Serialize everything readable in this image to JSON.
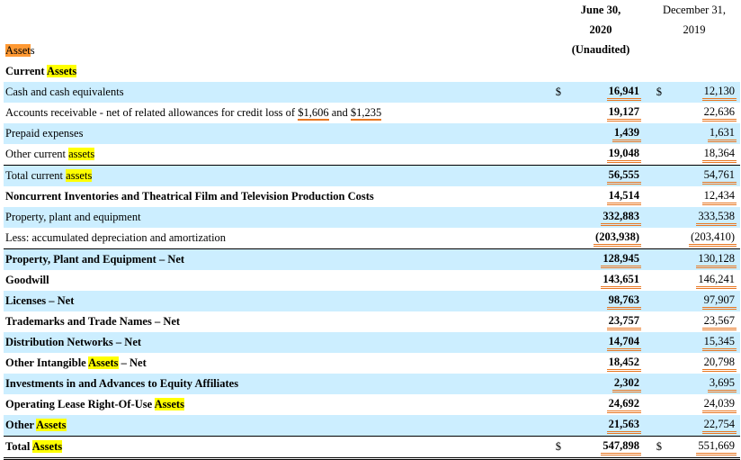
{
  "header": {
    "col1_line1": "June 30,",
    "col1_line2": "2020",
    "col1_line3": "(Unaudited)",
    "col2_line1": "December 31,",
    "col2_line2": "2019"
  },
  "section": {
    "prefix": "Asset",
    "suffix": "s"
  },
  "current_assets_heading": {
    "text": "Current ",
    "highlight": "Assets"
  },
  "rows": [
    {
      "label": "Cash and cash equivalents",
      "cur1": "$",
      "v1": "16,941",
      "cur2": "$",
      "v2": "12,130"
    },
    {
      "label_pre": "Accounts receivable - net of related allowances for credit loss of ",
      "label_a": "$1,606",
      "label_mid": " and ",
      "label_b": "$1,235",
      "v1": "19,127",
      "v2": "22,636"
    },
    {
      "label": "Prepaid expenses",
      "v1": "1,439",
      "v2": "1,631"
    },
    {
      "label_pre": "Other current ",
      "label_hl": "assets",
      "v1": "19,048",
      "v2": "18,364"
    },
    {
      "label_pre": "Total current ",
      "label_hl": "assets",
      "v1": "56,555",
      "v2": "54,761"
    },
    {
      "label": "Noncurrent Inventories and Theatrical Film and Television Production Costs",
      "v1": "14,514",
      "v2": "12,434"
    },
    {
      "label": "Property, plant and equipment",
      "v1": "332,883",
      "v2": "333,538"
    },
    {
      "label": "Less: accumulated depreciation and amortization",
      "v1": "(203,938)",
      "v2": "(203,410)"
    },
    {
      "label": "Property, Plant and Equipment – Net",
      "v1": "128,945",
      "v2": "130,128"
    },
    {
      "label": "Goodwill",
      "v1": "143,651",
      "v2": "146,241"
    },
    {
      "label": "Licenses – Net",
      "v1": "98,763",
      "v2": "97,907"
    },
    {
      "label": "Trademarks and Trade Names – Net",
      "v1": "23,757",
      "v2": "23,567"
    },
    {
      "label": "Distribution Networks – Net",
      "v1": "14,704",
      "v2": "15,345"
    },
    {
      "label_pre": "Other Intangible ",
      "label_hl": "Assets",
      "label_post": " – Net",
      "v1": "18,452",
      "v2": "20,798"
    },
    {
      "label": "Investments in and Advances to Equity Affiliates",
      "v1": "2,302",
      "v2": "3,695"
    },
    {
      "label_pre": "Operating Lease Right-Of-Use ",
      "label_hl": "Assets",
      "v1": "24,692",
      "v2": "24,039"
    },
    {
      "label_pre": "Other ",
      "label_hl": "Assets",
      "v1": "21,563",
      "v2": "22,754"
    },
    {
      "label_pre": "Total ",
      "label_hl": "Assets",
      "cur1": "$",
      "v1": "547,898",
      "cur2": "$",
      "v2": "551,669"
    }
  ]
}
